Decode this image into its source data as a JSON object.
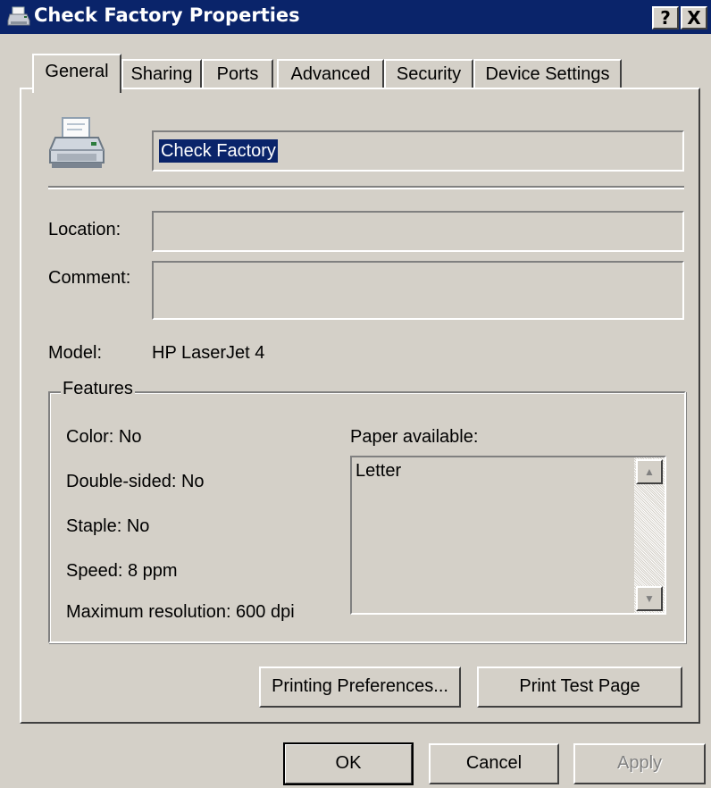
{
  "window": {
    "title": "Check Factory Properties",
    "help_label": "?",
    "close_label": "X"
  },
  "tabs": [
    {
      "label": "General",
      "active": true
    },
    {
      "label": "Sharing"
    },
    {
      "label": "Ports"
    },
    {
      "label": "Advanced"
    },
    {
      "label": "Security"
    },
    {
      "label": "Device Settings"
    }
  ],
  "general": {
    "printer_name": "Check Factory",
    "location_label": "Location:",
    "location_value": "",
    "comment_label": "Comment:",
    "comment_value": "",
    "model_label": "Model:",
    "model_value": "HP LaserJet 4",
    "features": {
      "legend": "Features",
      "color": "Color: No",
      "double_sided": "Double-sided: No",
      "staple": "Staple: No",
      "speed": "Speed: 8 ppm",
      "max_resolution": "Maximum resolution: 600 dpi",
      "paper_label": "Paper available:",
      "paper_items": [
        "Letter"
      ]
    },
    "printing_prefs_button": "Printing Preferences...",
    "print_test_button": "Print Test Page"
  },
  "footer": {
    "ok": "OK",
    "cancel": "Cancel",
    "apply": "Apply"
  },
  "icons": {
    "title_icon": "printer-icon",
    "main_icon": "printer-icon"
  },
  "colors": {
    "titlebar": "#0a246a",
    "face": "#d4d0c8",
    "selection": "#0a246a"
  }
}
